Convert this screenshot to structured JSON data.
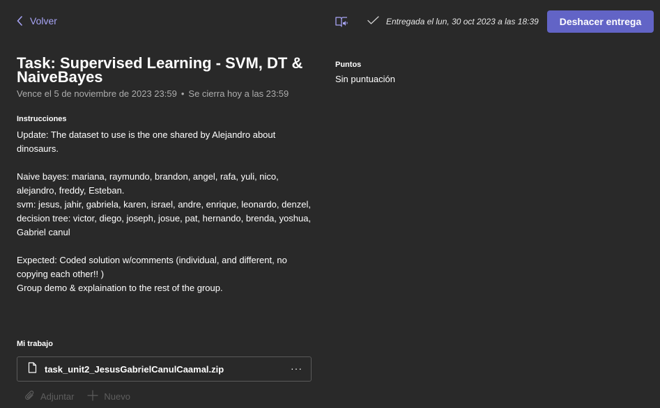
{
  "header": {
    "back_label": "Volver",
    "status_text": "Entregada el lun, 30 oct 2023 a las 18:39",
    "undo_button_label": "Deshacer entrega"
  },
  "assignment": {
    "title": "Task: Supervised Learning - SVM, DT & NaiveBayes",
    "due_text": "Vence el 5 de noviembre de 2023 23:59",
    "due_separator": "•",
    "closes_text": "Se cierra hoy a las 23:59"
  },
  "instructions": {
    "label": "Instrucciones",
    "paragraphs": [
      "Update: The dataset to use is the one shared by Alejandro about dinosaurs.",
      "",
      "Naive bayes: mariana, raymundo, brandon, angel, rafa, yuli, nico, alejandro, freddy, Esteban.",
      "svm: jesus, jahir, gabriela, karen, israel, andre, enrique, leonardo, denzel,",
      "decision tree: victor, diego, joseph, josue, pat, hernando, brenda, yoshua, Gabriel canul",
      "",
      "Expected: Coded solution w/comments (individual, and different, no copying each other!! )",
      "Group demo & explaination to the rest of the group."
    ]
  },
  "my_work": {
    "label": "Mi trabajo",
    "file_name": "task_unit2_JesusGabrielCanulCaamal.zip",
    "more_label": "···",
    "attach_label": "Adjuntar",
    "new_label": "Nuevo"
  },
  "points": {
    "label": "Puntos",
    "value": "Sin puntuación"
  },
  "colors": {
    "background": "#292929",
    "accent": "#6264c6",
    "link": "#a7a4f5",
    "muted_text": "#adadad",
    "disabled_text": "#5e5e5e"
  },
  "icons": {
    "back": "chevron-left-icon",
    "reader": "immersive-reader-icon",
    "status": "checkmark-icon",
    "file": "document-icon",
    "attach": "paperclip-icon",
    "new": "plus-icon"
  }
}
